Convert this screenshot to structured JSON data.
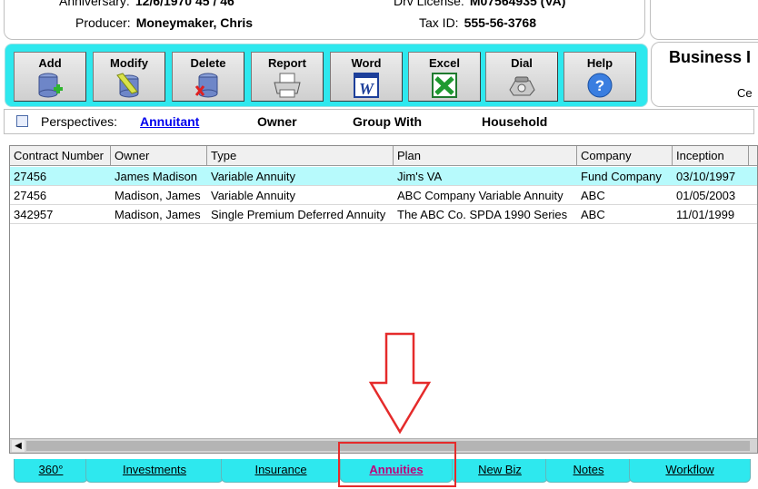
{
  "header": {
    "anniversary_label": "Anniversary:",
    "anniversary_value": "12/6/1970  45 / 46",
    "dl_label": "Drv License:",
    "dl_value": "M07564935 (VA)",
    "producer_label": "Producer:",
    "producer_value": "Moneymaker, Chris",
    "taxid_label": "Tax ID:",
    "taxid_value": "555-56-3768"
  },
  "toolbar": {
    "buttons": [
      {
        "label": "Add",
        "icon": "database-add-icon"
      },
      {
        "label": "Modify",
        "icon": "database-edit-icon"
      },
      {
        "label": "Delete",
        "icon": "database-delete-icon"
      },
      {
        "label": "Report",
        "icon": "printer-icon"
      },
      {
        "label": "Word",
        "icon": "word-icon"
      },
      {
        "label": "Excel",
        "icon": "excel-icon"
      },
      {
        "label": "Dial",
        "icon": "phone-icon"
      },
      {
        "label": "Help",
        "icon": "help-icon"
      }
    ]
  },
  "business_panel": {
    "title": "Business I",
    "subtitle": "Ce"
  },
  "perspectives": {
    "label": "Perspectives:",
    "items": [
      "Annuitant",
      "Owner",
      "Group With",
      "Household"
    ],
    "active": "Annuitant"
  },
  "grid": {
    "columns": [
      "Contract Number",
      "Owner",
      "Type",
      "Plan",
      "Company",
      "Inception"
    ],
    "rows": [
      [
        "27456",
        "James Madison",
        "Variable Annuity",
        "Jim's VA",
        "Fund Company",
        "03/10/1997"
      ],
      [
        "27456",
        "Madison, James",
        "Variable Annuity",
        "ABC Company Variable Annuity",
        "ABC",
        "01/05/2003"
      ],
      [
        "342957",
        "Madison, James",
        "Single Premium Deferred Annuity",
        "The ABC Co. SPDA 1990 Series",
        "ABC",
        "11/01/1999"
      ]
    ],
    "selected_row": 0
  },
  "tabs": {
    "items": [
      "360°",
      "Investments",
      "Insurance",
      "Annuities",
      "New Biz",
      "Notes",
      "Workflow"
    ],
    "active": "Annuities"
  },
  "colors": {
    "toolbar": "#2ee8ee",
    "selected_row": "#b7fafc",
    "highlight": "#e52b2b",
    "active_tab_text": "#c0007a"
  }
}
